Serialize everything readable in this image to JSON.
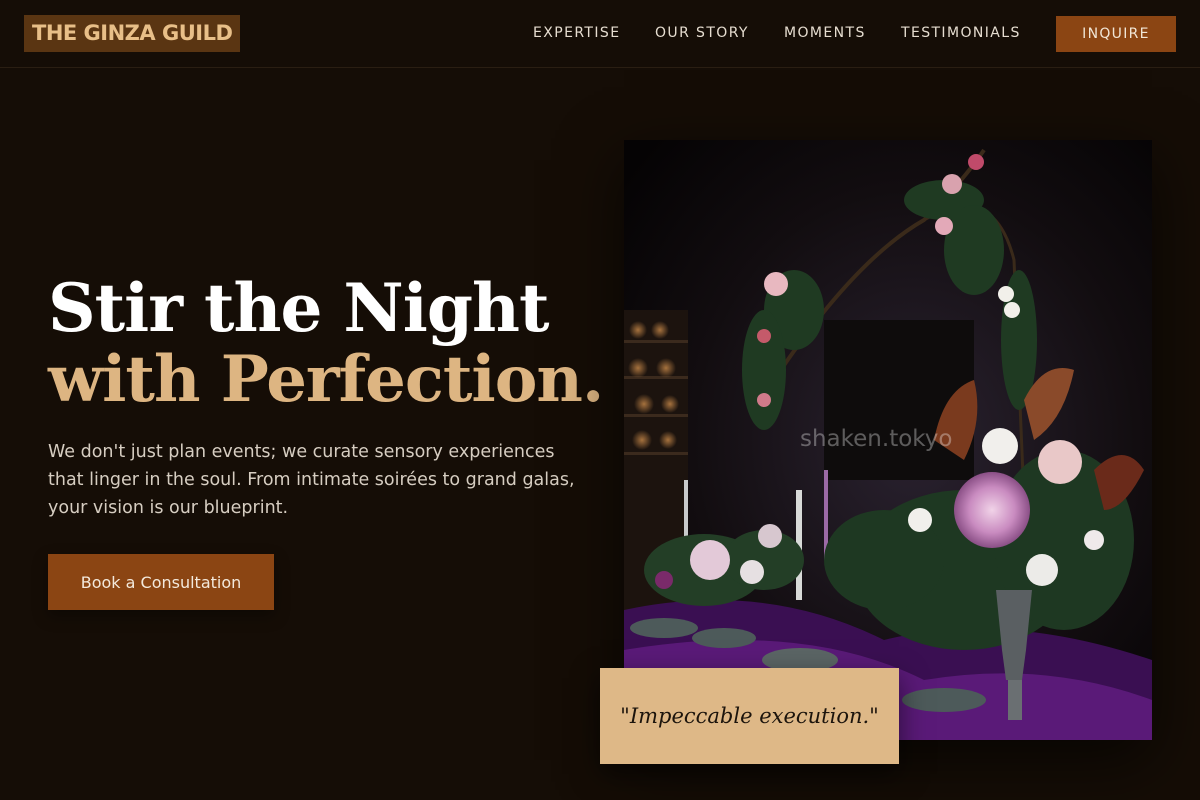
{
  "brand": {
    "name": "THE GINZA GUILD"
  },
  "nav": {
    "links": [
      "EXPERTISE",
      "OUR STORY",
      "MOMENTS",
      "TESTIMONIALS"
    ],
    "cta_label": "INQUIRE"
  },
  "hero": {
    "title_line1": "Stir the Night",
    "title_line2": "with Perfection.",
    "description": "We don't just plan events; we curate sensory experiences that linger in the soul. From intimate soirées to grand galas, your vision is our blueprint.",
    "cta_label": "Book a Consultation"
  },
  "photo": {
    "watermark": "shaken.tokyo"
  },
  "quote": {
    "text": "\"Impeccable execution.\""
  },
  "colors": {
    "background": "#150d06",
    "accent": "#8b4513",
    "gold": "#ddb582",
    "quote_card": "#deb887"
  },
  "icons": []
}
